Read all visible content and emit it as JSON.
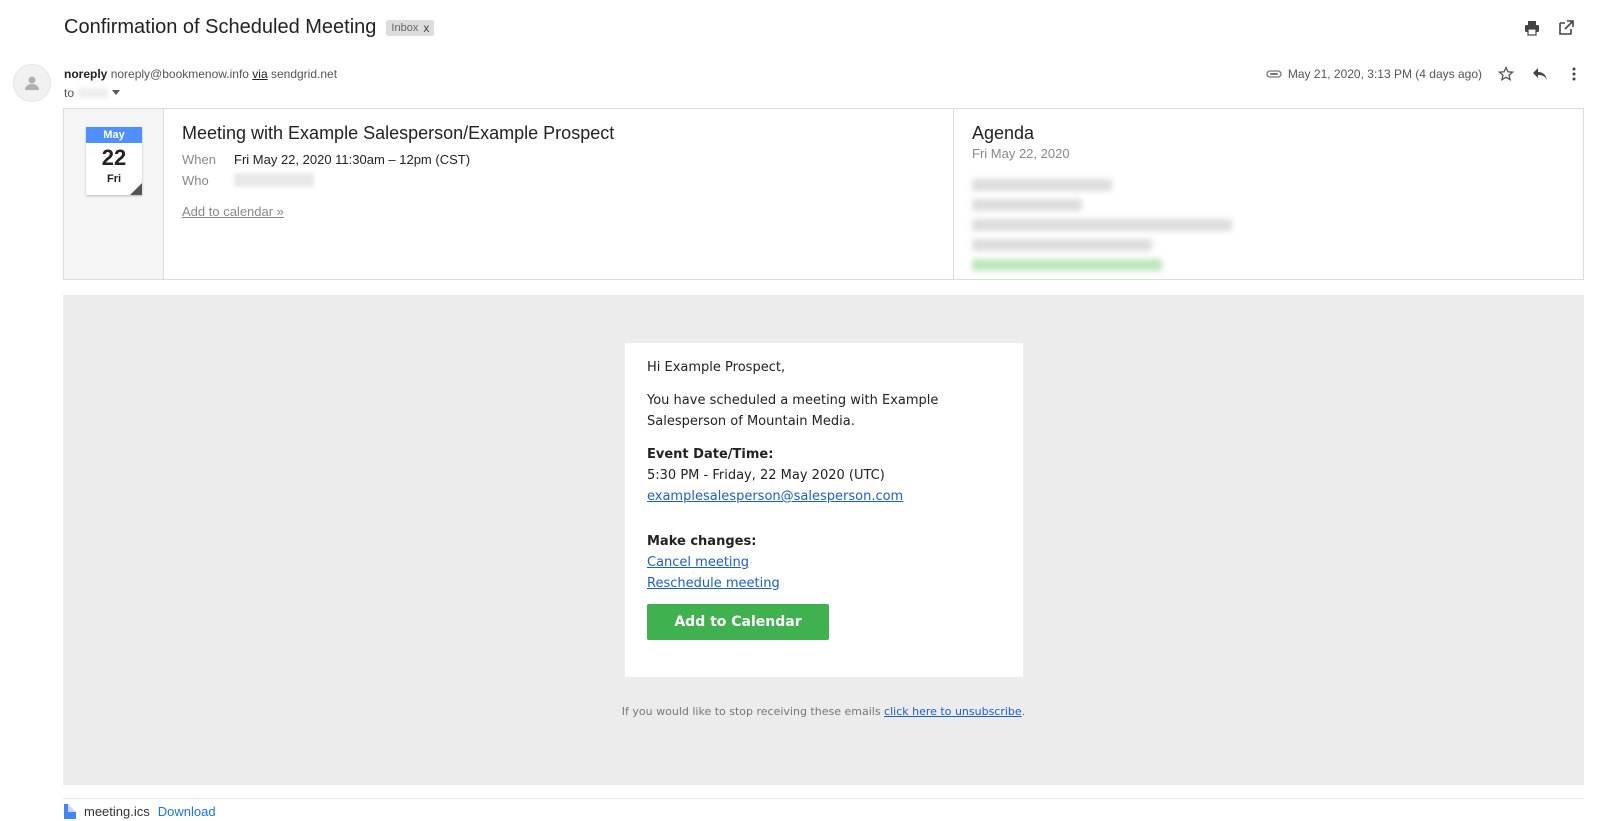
{
  "header": {
    "subject": "Confirmation of Scheduled Meeting",
    "label": "Inbox",
    "label_close": "x"
  },
  "sender": {
    "name": "noreply",
    "email": "noreply@bookmenow.info",
    "via_label": "via",
    "via_domain": "sendgrid.net",
    "to_label": "to",
    "timestamp": "May 21, 2020, 3:13 PM (4 days ago)"
  },
  "invite": {
    "cal_month": "May",
    "cal_day": "22",
    "cal_weekday": "Fri",
    "title": "Meeting with Example Salesperson/Example Prospect",
    "when_label": "When",
    "when_value": "Fri May 22, 2020 11:30am – 12pm (CST)",
    "who_label": "Who",
    "add_link": "Add to calendar »",
    "agenda_title": "Agenda",
    "agenda_date": "Fri May 22, 2020"
  },
  "body": {
    "greeting": "Hi Example Prospect,",
    "intro": "You have scheduled a meeting with Example Salesperson of Mountain Media.",
    "event_heading": "Event Date/Time:",
    "event_time": "5:30 PM - Friday, 22 May 2020 (UTC)",
    "contact_email": "examplesalesperson@salesperson.com",
    "changes_heading": "Make changes:",
    "cancel_link": "Cancel meeting",
    "reschedule_link": "Reschedule meeting",
    "add_button": "Add to Calendar",
    "unsub_text": "If you would like to stop receiving these emails ",
    "unsub_link": "click here to unsubscribe",
    "unsub_end": "."
  },
  "attachment": {
    "filename": "meeting.ics",
    "download": "Download"
  },
  "colors": {
    "accent_blue": "#4d90fe",
    "button_green": "#3fb14f",
    "link_blue": "#1a5fd0"
  }
}
